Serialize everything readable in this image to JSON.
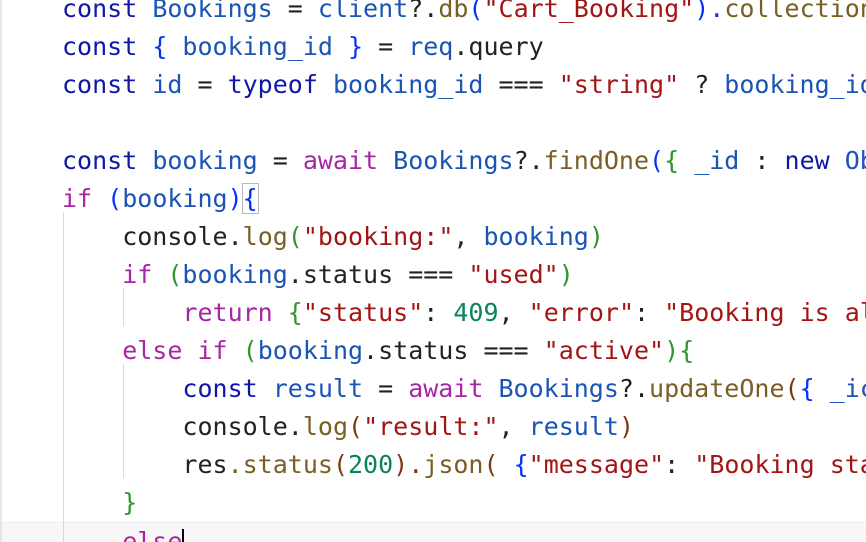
{
  "editor": {
    "lines": [
      [
        {
          "t": "const ",
          "c": "kw"
        },
        {
          "t": "Bookings",
          "c": "var"
        },
        {
          "t": " = ",
          "c": "op"
        },
        {
          "t": "client",
          "c": "var"
        },
        {
          "t": "?.",
          "c": "op"
        },
        {
          "t": "db",
          "c": "fn"
        },
        {
          "t": "(",
          "c": "p1"
        },
        {
          "t": "\"Cart_Booking\"",
          "c": "str"
        },
        {
          "t": ").",
          "c": "p1"
        },
        {
          "t": "collection",
          "c": "fn"
        }
      ],
      [
        {
          "t": "const ",
          "c": "kw"
        },
        {
          "t": "{ ",
          "c": "p1"
        },
        {
          "t": "booking_id",
          "c": "var"
        },
        {
          "t": " } ",
          "c": "p1"
        },
        {
          "t": "= ",
          "c": "op"
        },
        {
          "t": "req",
          "c": "var"
        },
        {
          "t": ".query",
          "c": "op"
        }
      ],
      [
        {
          "t": "const ",
          "c": "kw"
        },
        {
          "t": "id",
          "c": "var"
        },
        {
          "t": " = ",
          "c": "op"
        },
        {
          "t": "typeof ",
          "c": "kw"
        },
        {
          "t": "booking_id",
          "c": "var"
        },
        {
          "t": " === ",
          "c": "op"
        },
        {
          "t": "\"string\"",
          "c": "str"
        },
        {
          "t": " ? ",
          "c": "op"
        },
        {
          "t": "booking_id",
          "c": "var"
        }
      ],
      [],
      [
        {
          "t": "const ",
          "c": "kw"
        },
        {
          "t": "booking",
          "c": "var"
        },
        {
          "t": " = ",
          "c": "op"
        },
        {
          "t": "await ",
          "c": "kw2"
        },
        {
          "t": "Bookings",
          "c": "var"
        },
        {
          "t": "?.",
          "c": "op"
        },
        {
          "t": "findOne",
          "c": "fn"
        },
        {
          "t": "(",
          "c": "p1"
        },
        {
          "t": "{ ",
          "c": "p2"
        },
        {
          "t": "_id",
          "c": "var"
        },
        {
          "t": " : ",
          "c": "op"
        },
        {
          "t": "new ",
          "c": "kw"
        },
        {
          "t": "Ob",
          "c": "var"
        }
      ],
      [
        {
          "t": "if ",
          "c": "kw2"
        },
        {
          "t": "(",
          "c": "p1"
        },
        {
          "t": "booking",
          "c": "var"
        },
        {
          "t": ")",
          "c": "p1"
        },
        {
          "t": "{",
          "c": "p1",
          "m": true
        }
      ],
      [
        {
          "t": "    console",
          "c": "op"
        },
        {
          "t": ".",
          "c": "op"
        },
        {
          "t": "log",
          "c": "fn"
        },
        {
          "t": "(",
          "c": "p2"
        },
        {
          "t": "\"booking:\"",
          "c": "str"
        },
        {
          "t": ", ",
          "c": "op"
        },
        {
          "t": "booking",
          "c": "var"
        },
        {
          "t": ")",
          "c": "p2"
        }
      ],
      [
        {
          "t": "    if ",
          "c": "kw2"
        },
        {
          "t": "(",
          "c": "p2"
        },
        {
          "t": "booking",
          "c": "var"
        },
        {
          "t": ".status",
          "c": "op"
        },
        {
          "t": " === ",
          "c": "op"
        },
        {
          "t": "\"used\"",
          "c": "str"
        },
        {
          "t": ")",
          "c": "p2"
        }
      ],
      [
        {
          "t": "        return ",
          "c": "kw2"
        },
        {
          "t": "{",
          "c": "p2"
        },
        {
          "t": "\"status\"",
          "c": "str"
        },
        {
          "t": ": ",
          "c": "op"
        },
        {
          "t": "409",
          "c": "num"
        },
        {
          "t": ", ",
          "c": "op"
        },
        {
          "t": "\"error\"",
          "c": "str"
        },
        {
          "t": ": ",
          "c": "op"
        },
        {
          "t": "\"Booking is al",
          "c": "str"
        }
      ],
      [
        {
          "t": "    else if ",
          "c": "kw2"
        },
        {
          "t": "(",
          "c": "p2"
        },
        {
          "t": "booking",
          "c": "var"
        },
        {
          "t": ".status",
          "c": "op"
        },
        {
          "t": " === ",
          "c": "op"
        },
        {
          "t": "\"active\"",
          "c": "str"
        },
        {
          "t": ")",
          "c": "p2"
        },
        {
          "t": "{",
          "c": "p2"
        }
      ],
      [
        {
          "t": "        const ",
          "c": "kw"
        },
        {
          "t": "result",
          "c": "var"
        },
        {
          "t": " = ",
          "c": "op"
        },
        {
          "t": "await ",
          "c": "kw2"
        },
        {
          "t": "Bookings",
          "c": "var"
        },
        {
          "t": "?.",
          "c": "op"
        },
        {
          "t": "updateOne",
          "c": "fn"
        },
        {
          "t": "(",
          "c": "p3"
        },
        {
          "t": "{ ",
          "c": "p1"
        },
        {
          "t": "_ic",
          "c": "var"
        }
      ],
      [
        {
          "t": "        console",
          "c": "op"
        },
        {
          "t": ".",
          "c": "op"
        },
        {
          "t": "log",
          "c": "fn"
        },
        {
          "t": "(",
          "c": "p3"
        },
        {
          "t": "\"result:\"",
          "c": "str"
        },
        {
          "t": ", ",
          "c": "op"
        },
        {
          "t": "result",
          "c": "var"
        },
        {
          "t": ")",
          "c": "p3"
        }
      ],
      [
        {
          "t": "        res",
          "c": "op"
        },
        {
          "t": ".status",
          "c": "fn"
        },
        {
          "t": "(",
          "c": "p3"
        },
        {
          "t": "200",
          "c": "num"
        },
        {
          "t": ").",
          "c": "p3"
        },
        {
          "t": "json",
          "c": "fn"
        },
        {
          "t": "( ",
          "c": "p3"
        },
        {
          "t": "{",
          "c": "p1"
        },
        {
          "t": "\"message\"",
          "c": "str"
        },
        {
          "t": ": ",
          "c": "op"
        },
        {
          "t": "\"Booking sta",
          "c": "str"
        }
      ],
      [
        {
          "t": "    }",
          "c": "p2"
        }
      ],
      [
        {
          "t": "    else",
          "c": "kw2",
          "cursor": true
        }
      ]
    ]
  }
}
